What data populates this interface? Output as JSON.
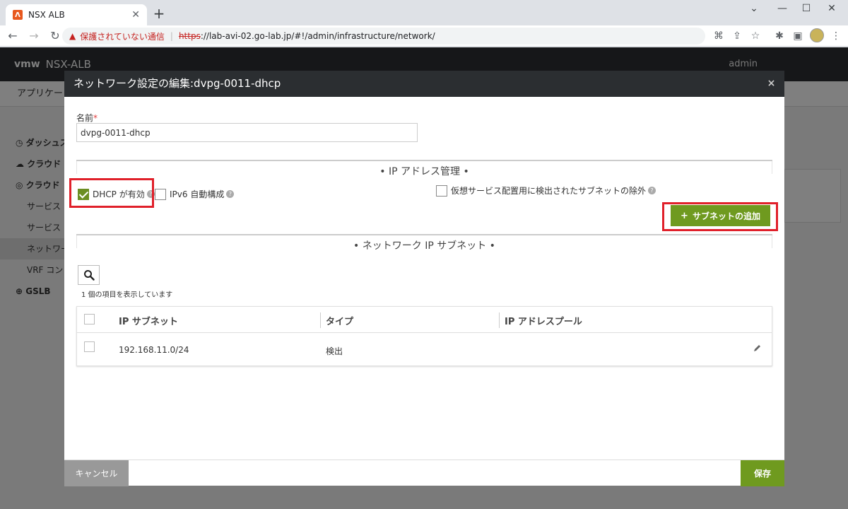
{
  "browser": {
    "tab_title": "NSX ALB",
    "tab_favicon": "Λ",
    "new_tab": "+",
    "warning_text": "保護されていない通信",
    "url_scheme": "https",
    "url_rest": "://lab-avi-02.go-lab.jp/#!/admin/infrastructure/network/"
  },
  "app": {
    "logo": "vmw",
    "name": "NSX-ALB",
    "user": "admin",
    "subheader": "アプリケー",
    "sidebar": [
      {
        "label": "ダッシュス",
        "icon": "dashboard-icon"
      },
      {
        "label": "クラウド",
        "icon": "cloud-icon"
      },
      {
        "label": "クラウド",
        "icon": "cloud-services-icon"
      },
      {
        "label": "サービス"
      },
      {
        "label": "サービス"
      },
      {
        "label": "ネットワー"
      },
      {
        "label": "VRF コン"
      },
      {
        "label": "GSLB",
        "icon": "gslb-icon"
      }
    ]
  },
  "modal": {
    "title": "ネットワーク設定の編集:dvpg-0011-dhcp",
    "close": "×",
    "name_label": "名前",
    "name_required": "*",
    "name_value": "dvpg-0011-dhcp",
    "ip_section_title": "• IP アドレス管理 •",
    "dhcp_label": "DHCP が有効",
    "dhcp_checked": true,
    "ipv6_label": "IPv6 自動構成",
    "ipv6_checked": false,
    "exclude_label": "仮想サービス配置用に検出されたサブネットの除外",
    "exclude_checked": false,
    "add_subnet_label": "サブネットの追加",
    "add_subnet_plus": "+",
    "subnet_section_title": "• ネットワーク IP サブネット •",
    "count_text": "1 個の項目を表示しています",
    "table": {
      "headers": [
        "IP サブネット",
        "タイプ",
        "IP アドレスプール"
      ],
      "rows": [
        {
          "subnet": "192.168.11.0/24",
          "type": "検出",
          "pool": ""
        }
      ]
    },
    "cancel_label": "キャンセル",
    "save_label": "保存"
  },
  "colors": {
    "accent_green": "#6f9a1f",
    "highlight_red": "#e0202a",
    "header_dark": "#2b2e31"
  }
}
